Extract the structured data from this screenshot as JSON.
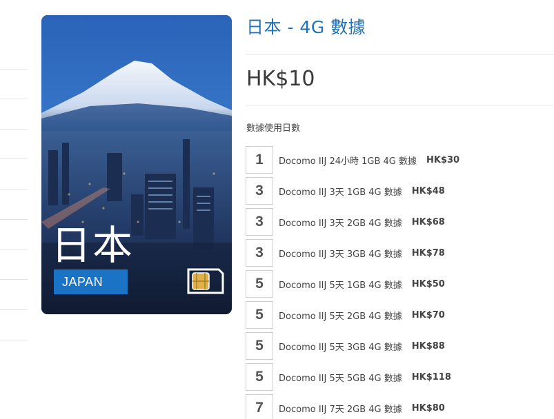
{
  "product": {
    "title": "日本 - 4G 數據",
    "price": "HK$10",
    "card_title": "日本",
    "card_badge": "JAPAN"
  },
  "options": {
    "label": "數據使用日數",
    "items": [
      {
        "days": "1",
        "name": "Docomo IIJ 24小時 1GB 4G 數據",
        "price": "HK$30"
      },
      {
        "days": "3",
        "name": "Docomo IIJ 3天 1GB 4G 數據",
        "price": "HK$48"
      },
      {
        "days": "3",
        "name": "Docomo IIJ 3天 2GB 4G 數據",
        "price": "HK$68"
      },
      {
        "days": "3",
        "name": "Docomo IIJ 3天 3GB 4G 數據",
        "price": "HK$78"
      },
      {
        "days": "5",
        "name": "Docomo IIJ 5天 1GB 4G 數據",
        "price": "HK$50"
      },
      {
        "days": "5",
        "name": "Docomo IIJ 5天 2GB 4G 數據",
        "price": "HK$70"
      },
      {
        "days": "5",
        "name": "Docomo IIJ 5天 3GB 4G 數據",
        "price": "HK$88"
      },
      {
        "days": "5",
        "name": "Docomo IIJ 5天 5GB 4G 數據",
        "price": "HK$118"
      },
      {
        "days": "7",
        "name": "Docomo IIJ 7天 2GB 4G 數據",
        "price": "HK$80"
      }
    ]
  },
  "icons": {
    "card_icon": "sim-card-icon"
  },
  "colors": {
    "title_blue": "#1f72b8",
    "badge_blue": "#1a73c4",
    "sky_blue": "#2f6fc0"
  }
}
